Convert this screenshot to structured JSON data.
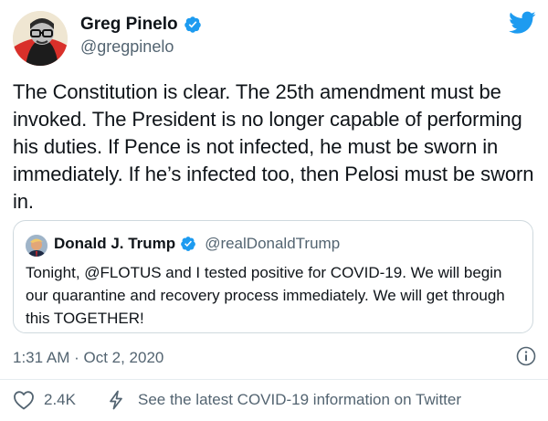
{
  "author": {
    "display_name": "Greg Pinelo",
    "handle": "@gregpinelo"
  },
  "tweet": {
    "text": "The Constitution is clear. The 25th amendment must be invoked. The President is no longer capable of performing his duties. If Pence is not infected, he must be sworn in immediately. If he’s infected too, then Pelosi must be sworn in.",
    "timestamp": "1:31 AM · Oct 2, 2020"
  },
  "quoted_tweet": {
    "display_name": "Donald J. Trump",
    "handle": "@realDonaldTrump",
    "text": "Tonight, @FLOTUS and I tested positive for COVID-19. We will begin our quarantine and recovery process immediately. We will get through this TOGETHER!"
  },
  "actions": {
    "like_count": "2.4K",
    "covid_info_link": "See the latest COVID-19 information on Twitter"
  },
  "icons": {
    "brand": "twitter-bird-icon",
    "verified": "verified-badge-icon",
    "info": "info-icon",
    "like": "heart-icon",
    "covid": "lightning-bolt-icon"
  },
  "colors": {
    "twitter_blue": "#1d9bf0",
    "text_primary": "#0f1419",
    "text_secondary": "#536471",
    "border": "#cfd9de"
  }
}
